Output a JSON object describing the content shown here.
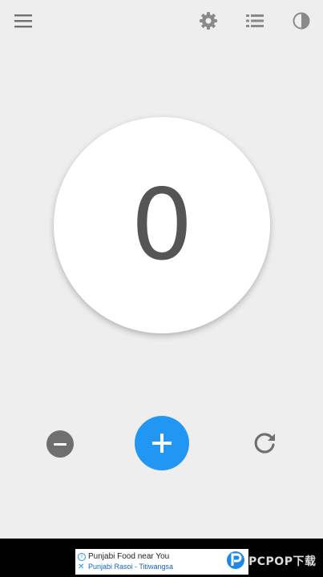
{
  "toolbar": {
    "icons": [
      "menu-icon",
      "settings-icon",
      "list-icon",
      "theme-toggle-icon"
    ]
  },
  "counter": {
    "value": "0"
  },
  "controls": {
    "decrement_icon": "minus-icon",
    "increment_icon": "plus-icon",
    "reset_icon": "refresh-icon",
    "accent_color": "#2196f3"
  },
  "ad": {
    "title": "Punjabi Food near You",
    "subtitle": "Punjabi Rasoi - Titiwangsa"
  },
  "watermark": {
    "text": "PCPOP下载"
  }
}
